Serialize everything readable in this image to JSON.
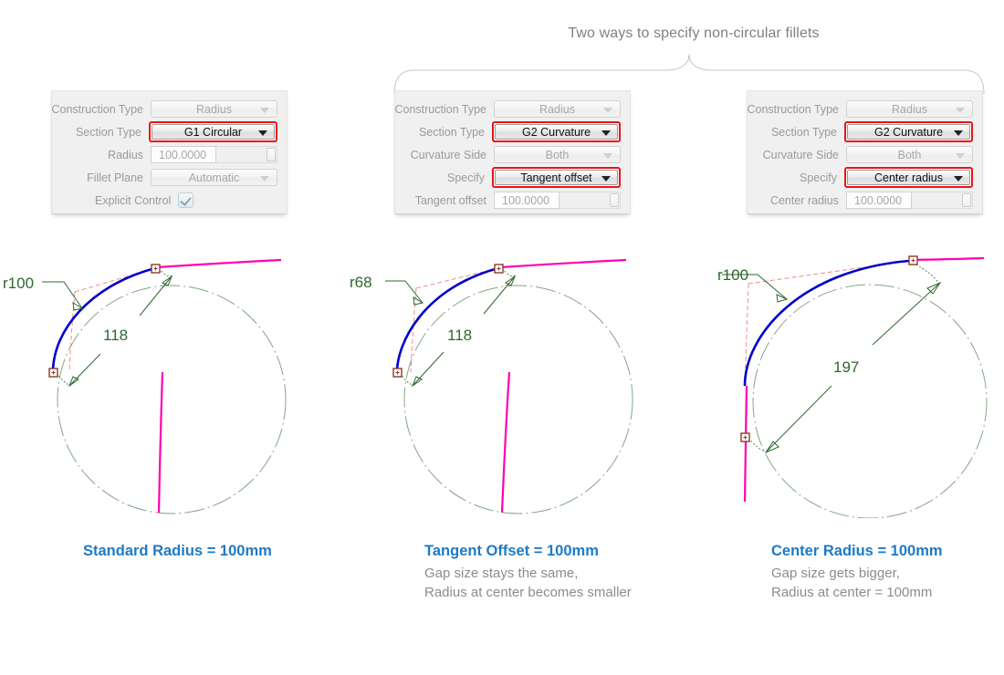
{
  "header": {
    "title": "Two ways to specify non-circular fillets",
    "bracket": "curly-brace-bracket"
  },
  "panels": [
    {
      "id": "panel-standard-radius",
      "rows": [
        {
          "label": "Construction Type",
          "type": "combo",
          "value": "Radius",
          "highlighted": false
        },
        {
          "label": "Section Type",
          "type": "combo",
          "value": "G1 Circular",
          "highlighted": true
        },
        {
          "label": "Radius",
          "type": "number",
          "value": "100.0000"
        },
        {
          "label": "Fillet Plane",
          "type": "combo",
          "value": "Automatic",
          "highlighted": false
        },
        {
          "label": "Explicit Control",
          "type": "checkbox",
          "value": "checked"
        }
      ]
    },
    {
      "id": "panel-tangent-offset",
      "rows": [
        {
          "label": "Construction Type",
          "type": "combo",
          "value": "Radius",
          "highlighted": false
        },
        {
          "label": "Section Type",
          "type": "combo",
          "value": "G2 Curvature",
          "highlighted": true
        },
        {
          "label": "Curvature Side",
          "type": "combo",
          "value": "Both",
          "highlighted": false
        },
        {
          "label": "Specify",
          "type": "combo",
          "value": "Tangent offset",
          "highlighted": true
        },
        {
          "label": "Tangent offset",
          "type": "number",
          "value": "100.0000"
        }
      ]
    },
    {
      "id": "panel-center-radius",
      "rows": [
        {
          "label": "Construction Type",
          "type": "combo",
          "value": "Radius",
          "highlighted": false
        },
        {
          "label": "Section Type",
          "type": "combo",
          "value": "G2 Curvature",
          "highlighted": true
        },
        {
          "label": "Curvature Side",
          "type": "combo",
          "value": "Both",
          "highlighted": false
        },
        {
          "label": "Specify",
          "type": "combo",
          "value": "Center radius",
          "highlighted": true
        },
        {
          "label": "Center radius",
          "type": "number",
          "value": "100.0000"
        }
      ]
    }
  ],
  "diagrams": [
    {
      "id": "diagram-standard-radius",
      "radius_label": "r100",
      "gap_label": "118"
    },
    {
      "id": "diagram-tangent-offset",
      "radius_label": "r68",
      "gap_label": "118"
    },
    {
      "id": "diagram-center-radius",
      "radius_label": "r100",
      "gap_label": "197"
    }
  ],
  "captions": [
    {
      "title": "Standard Radius = 100mm",
      "line1": "",
      "line2": ""
    },
    {
      "title": "Tangent Offset = 100mm",
      "line1": "Gap size stays the same,",
      "line2": "Radius at center becomes smaller"
    },
    {
      "title": "Center Radius = 100mm",
      "line1": "Gap size gets bigger,",
      "line2": "Radius at center = 100mm"
    }
  ],
  "colors": {
    "accent_blue": "#1f7ac4",
    "curve_magenta": "#ff00b0",
    "fillet_blue": "#0000cc",
    "dimension_green": "#2d682d",
    "construction_salmon": "#f08080",
    "marker_brown": "#8b3a2a",
    "highlight_red": "#ee1111",
    "caption_gray": "#8c8c8c",
    "header_gray": "#808080"
  }
}
